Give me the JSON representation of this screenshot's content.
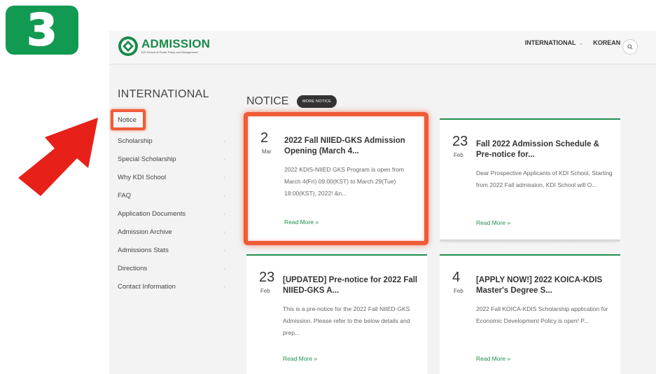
{
  "step": {
    "number": "3"
  },
  "colors": {
    "brand_green": "#1f8f4f",
    "badge_green": "#129a52",
    "highlight": "#ee5b36",
    "arrow_red": "#e8201a"
  },
  "header": {
    "logo_title": "ADMISSION",
    "logo_subtitle": "KDI School of Public Policy and Management",
    "nav": [
      {
        "label": "INTERNATIONAL"
      },
      {
        "label": "KOREAN"
      }
    ],
    "search_icon": "search-icon"
  },
  "sidebar": {
    "title": "INTERNATIONAL",
    "items": [
      {
        "label": "Notice",
        "active": true
      },
      {
        "label": "Scholarship"
      },
      {
        "label": "Special Scholarship"
      },
      {
        "label": "Why KDI School"
      },
      {
        "label": "FAQ"
      },
      {
        "label": "Application Documents"
      },
      {
        "label": "Admission Archive"
      },
      {
        "label": "Admissions Stats"
      },
      {
        "label": "Directions"
      },
      {
        "label": "Contact Information"
      }
    ]
  },
  "notice": {
    "title": "NOTICE",
    "more_label": "MORE NOTICE",
    "cards": [
      {
        "day": "2",
        "month": "Mar",
        "title": "2022 Fall NIIED-GKS Admission Opening (March 4...",
        "desc": "2022 KDIS-NIIED GKS Program is open from March 4(Fri) 09:00(KST) to March 29(Tue) 18:00(KST), 2022! &n...",
        "more": "Read More »"
      },
      {
        "day": "23",
        "month": "Feb",
        "title": "Fall 2022 Admission Schedule & Pre-notice for...",
        "desc": "Dear Prospective Applicants of KDI School, Starting from 2022 Fall admission, KDI School will O...",
        "more": "Read More »"
      },
      {
        "day": "23",
        "month": "Feb",
        "title": "[UPDATED] Pre-notice for 2022 Fall NIIED-GKS A...",
        "desc": "This is a pre-notice for the 2022 Fall NIIED-GKS Admission. Please refer to the below details and prep...",
        "more": "Read More »"
      },
      {
        "day": "4",
        "month": "Feb",
        "title": "[APPLY NOW!] 2022 KOICA-KDIS Master's Degree S...",
        "desc": "2022 Fall KOICA-KDIS Scholarship application for Economic Development Policy is open! P...",
        "more": "Read More »"
      }
    ]
  }
}
